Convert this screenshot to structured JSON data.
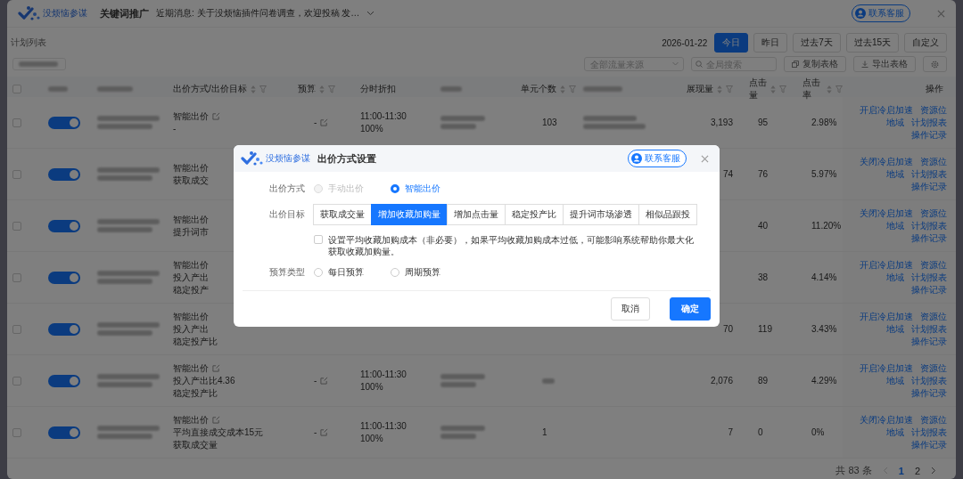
{
  "header": {
    "brand": "没烦恼参谋",
    "title": "关键词推广",
    "notice": "近期消息: 关于没烦恼插件问卷调查，欢迎投稿 发…",
    "contact": "联系客服"
  },
  "section_title": "计划列表",
  "date_filter": {
    "date": "2026-01-22",
    "ranges": [
      {
        "label": "今日",
        "selected": true
      },
      {
        "label": "昨日",
        "selected": false
      },
      {
        "label": "过去7天",
        "selected": false
      },
      {
        "label": "过去15天",
        "selected": false
      },
      {
        "label": "自定义",
        "selected": false
      }
    ]
  },
  "toolbar": {
    "source_placeholder": "全部流量来源",
    "search_placeholder": "全局搜索",
    "buttons": [
      {
        "label": "复制表格",
        "kind": "copy"
      },
      {
        "label": "导出表格",
        "kind": "export"
      }
    ]
  },
  "table": {
    "select_all_checked": false,
    "columns": [
      {
        "label": "出价方式/出价目标",
        "sortable": true
      },
      {
        "label": "预算",
        "sortable": true
      },
      {
        "label": "分时折扣",
        "sortable": false
      },
      {
        "label": "单元个数",
        "sortable": true
      },
      {
        "label": "展现量",
        "sortable": true
      },
      {
        "label": "点击量",
        "sortable": true
      },
      {
        "label": "点击率",
        "sortable": true
      },
      {
        "label": "操作",
        "sortable": false
      }
    ],
    "rows": [
      {
        "checked": false,
        "on": true,
        "under_dialog": false,
        "bid": [
          "智能出价",
          "-"
        ],
        "edit_icon": true,
        "budget": "-",
        "time": [
          "11:00-11:30",
          "100%"
        ],
        "units": "103",
        "impressions": "3,193",
        "clicks": "95",
        "ctr": "2.98%",
        "actions": [
          "开启冷启加速",
          "资源位",
          "地域",
          "计划报表",
          "操作记录"
        ]
      },
      {
        "checked": false,
        "on": true,
        "under_dialog": true,
        "bid": [
          "智能出价",
          "获取成交"
        ],
        "edit_icon": false,
        "impressions": "74",
        "clicks": "76",
        "ctr": "5.97%",
        "actions": [
          "关闭冷启加速",
          "资源位",
          "地域",
          "计划报表",
          "操作记录"
        ]
      },
      {
        "checked": false,
        "on": true,
        "under_dialog": true,
        "bid": [
          "智能出价",
          "提升词市"
        ],
        "edit_icon": false,
        "clicks": "40",
        "ctr": "11.20%",
        "actions": [
          "关闭冷启加速",
          "资源位",
          "地域",
          "计划报表",
          "操作记录"
        ]
      },
      {
        "checked": false,
        "on": true,
        "under_dialog": true,
        "bid": [
          "智能出价",
          "投入产出",
          "稳定投产"
        ],
        "edit_icon": false,
        "clicks": "38",
        "ctr": "4.14%",
        "actions": [
          "开启冷启加速",
          "资源位",
          "地域",
          "计划报表",
          "操作记录"
        ]
      },
      {
        "checked": false,
        "on": true,
        "under_dialog": true,
        "bid": [
          "智能出价",
          "投入产出",
          "稳定投产比"
        ],
        "edit_icon": false,
        "impressions": "70",
        "clicks": "119",
        "ctr": "3.43%",
        "actions": [
          "开启冷启加速",
          "资源位",
          "地域",
          "计划报表",
          "操作记录"
        ]
      },
      {
        "checked": false,
        "on": true,
        "under_dialog": false,
        "bid": [
          "智能出价",
          "投入产出比4.36",
          "稳定投产比"
        ],
        "edit_icon": true,
        "budget": "-",
        "time": [
          "11:00-11:30",
          "100%"
        ],
        "impressions": "2,076",
        "clicks": "89",
        "ctr": "4.29%",
        "actions": [
          "开启冷启加速",
          "资源位",
          "地域",
          "计划报表",
          "操作记录"
        ]
      },
      {
        "checked": false,
        "on": true,
        "under_dialog": false,
        "bid": [
          "智能出价",
          "平均直接成交成本15元",
          "获取成交量"
        ],
        "edit_icon": true,
        "budget": "-",
        "time": [
          "11:00-11:30",
          "100%"
        ],
        "units": "1",
        "impressions": "7",
        "clicks": "0",
        "ctr": "0%",
        "actions": [
          "关闭冷启加速",
          "资源位",
          "地域",
          "计划报表",
          "操作记录"
        ]
      }
    ]
  },
  "pagination": {
    "total": "共 83 条",
    "pages": [
      {
        "label": "1",
        "selected": true
      },
      {
        "label": "2",
        "selected": false
      }
    ]
  },
  "dialog": {
    "brand": "没烦恼参谋",
    "title": "出价方式设置",
    "contact": "联系客服",
    "bid_method": {
      "label": "出价方式",
      "options": [
        {
          "label": "手动出价",
          "selected": false,
          "disabled": true
        },
        {
          "label": "智能出价",
          "selected": true,
          "disabled": false
        }
      ]
    },
    "bid_goal": {
      "label": "出价目标",
      "options": [
        {
          "label": "获取成交量",
          "selected": false
        },
        {
          "label": "增加收藏加购量",
          "selected": true
        },
        {
          "label": "增加点击量",
          "selected": false
        },
        {
          "label": "稳定投产比",
          "selected": false
        },
        {
          "label": "提升词市场渗透",
          "selected": false
        },
        {
          "label": "相似品跟投",
          "selected": false
        }
      ]
    },
    "cost_option": {
      "label": "设置平均收藏加购成本（非必要），如果平均收藏加购成本过低，可能影响系统帮助你最大化获取收藏加购量。",
      "checked": false
    },
    "budget_type": {
      "label": "预算类型",
      "options": [
        {
          "label": "每日预算",
          "selected": false,
          "disabled": false
        },
        {
          "label": "周期预算",
          "selected": false,
          "disabled": false
        }
      ]
    },
    "buttons": [
      {
        "label": "取消",
        "kind": "secondary"
      },
      {
        "label": "确定",
        "kind": "primary"
      }
    ]
  }
}
